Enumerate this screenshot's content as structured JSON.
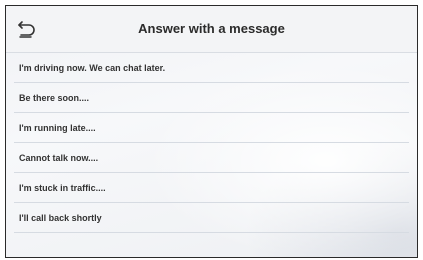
{
  "header": {
    "title": "Answer with a message",
    "back_icon": "back-arrow-icon"
  },
  "messages": [
    "I'm driving now. We can chat later.",
    "Be there soon....",
    "I'm running late....",
    "Cannot talk now....",
    "I'm stuck in traffic....",
    "I'll call back shortly"
  ]
}
